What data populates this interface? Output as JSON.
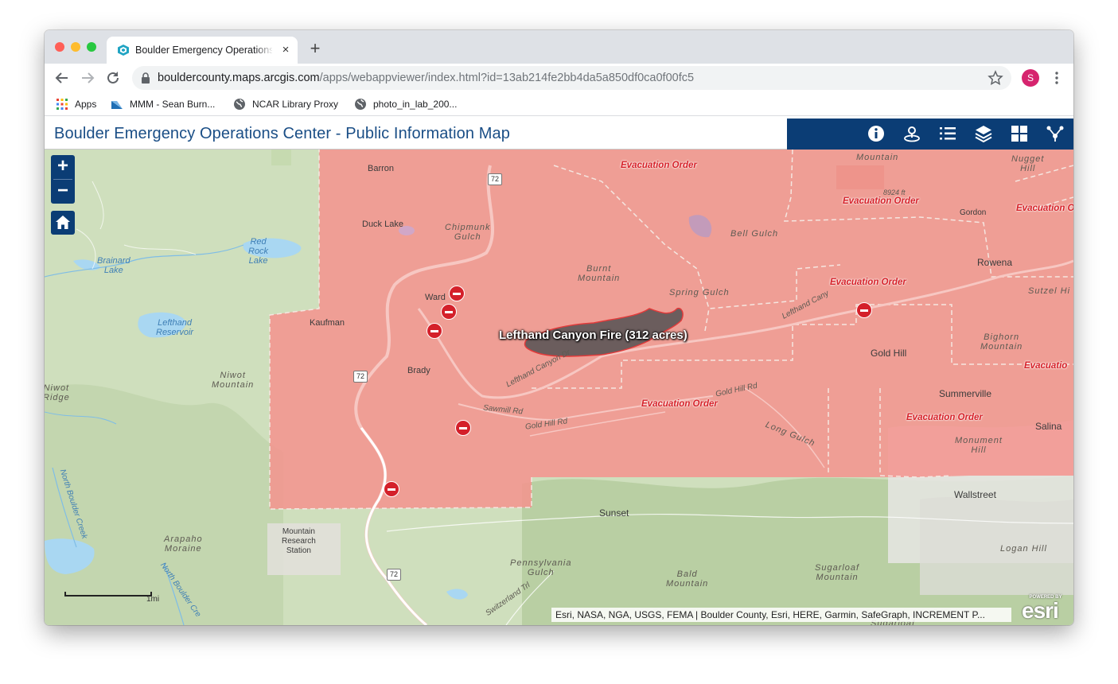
{
  "browser": {
    "tab": {
      "title": "Boulder Emergency Operations Center",
      "close": "×"
    },
    "new_tab": "+",
    "url": {
      "host": "bouldercounty.maps.arcgis.com",
      "path": "/apps/webappviewer/index.html?id=13ab214fe2bb4da5a850df0ca0f00fc5"
    },
    "profile_initial": "S",
    "bookmarks": [
      {
        "label": "Apps",
        "icon": "apps-grid-icon"
      },
      {
        "label": "MMM - Sean Burn...",
        "icon": "mmm-favicon"
      },
      {
        "label": "NCAR Library Proxy",
        "icon": "globe-icon"
      },
      {
        "label": "photo_in_lab_200...",
        "icon": "globe-icon"
      }
    ]
  },
  "app": {
    "title": "Boulder Emergency Operations Center - Public Information Map",
    "tools": [
      "info-icon",
      "locate-icon",
      "legend-list-icon",
      "layers-icon",
      "basemap-gallery-icon",
      "share-icon"
    ]
  },
  "map": {
    "zoom_in": "+",
    "zoom_out": "−",
    "fire_label": "Lefthand Canyon Fire (312 acres)",
    "evac": {
      "e1": "Evacuation Order",
      "e2": "Evacuation Order",
      "e3": "Evacuation O",
      "e4": "Evacuation Order",
      "e5": "Evacuation Order",
      "e6": "Evacuation Order",
      "e7": "Evacuatio"
    },
    "places": {
      "barron": "Barron",
      "duck_lake": "Duck Lake",
      "chipmunk": "Chipmunk\nGulch",
      "red_rock": "Red\nRock\nLake",
      "brainard": "Brainard\nLake",
      "ward": "Ward",
      "kaufman": "Kaufman",
      "lefthand_res": "Lefthand\nReservoir",
      "niwot_mtn": "Niwot\nMountain",
      "niwot_ridge": "Niwot\nRidge",
      "brady": "Brady",
      "burnt_mtn": "Burnt\nMountain",
      "spring_gulch": "Spring Gulch",
      "bell_gulch": "Bell Gulch",
      "mountain": "Mountain",
      "elev": "8924 ft",
      "gordon": "Gordon",
      "nugget": "Nugget\nHill",
      "rowena": "Rowena",
      "sutzel": "Sutzel Hi",
      "gold_hill": "Gold Hill",
      "bighorn": "Bighorn\nMountain",
      "summerville": "Summerville",
      "salina": "Salina",
      "monument": "Monument\nHill",
      "wallstreet": "Wallstreet",
      "logan": "Logan Hill",
      "sunset": "Sunset",
      "mrs": "Mountain\nResearch\nStation",
      "arapaho": "Arapaho\nMoraine",
      "pennsylvania": "Pennsylvania\nGulch",
      "bald": "Bald\nMountain",
      "sugarloaf_mtn": "Sugarloaf\nMountain",
      "sugarloaf": "Sugarloaf",
      "long_gulch": "Long Gulch",
      "sawmill": "Sawmill Rd",
      "gold_hill_rd": "Gold Hill Rd",
      "gold_hill_rd2": "Gold Hill Rd",
      "lefthand_dr": "Lefthand Canyon Dr",
      "lefthand_cyn": "Lefthand Cany",
      "switzerland": "Switzerland Trl",
      "north_boulder": "North Boulder Creek",
      "north_boulder2": "North Boulder Cre"
    },
    "shields": {
      "s1": "72",
      "s2": "72",
      "s3": "72"
    },
    "scale_label": "1mi",
    "attribution": "Esri, NASA, NGA, USGS, FEMA | Boulder County, Esri, HERE, Garmin, SafeGraph, INCREMENT P...",
    "esri_powered": "POWERED BY",
    "esri_word": "esri"
  }
}
